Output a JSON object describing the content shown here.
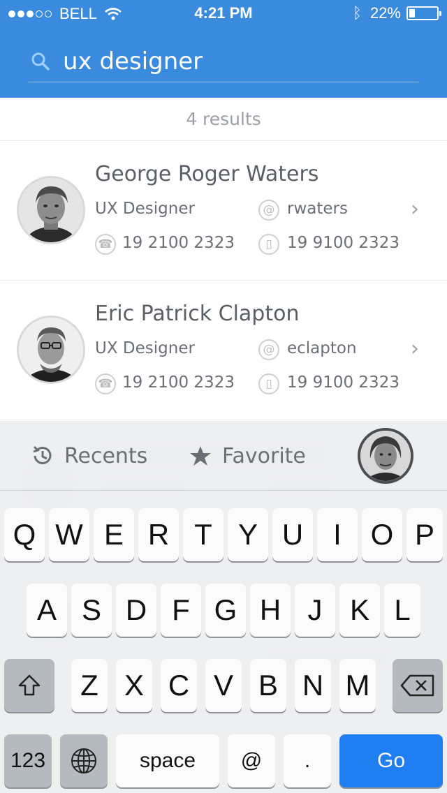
{
  "status_bar": {
    "carrier": "BELL",
    "time": "4:21 PM",
    "battery": "22%",
    "battery_level": 0.22
  },
  "search": {
    "value": "ux designer",
    "placeholder": ""
  },
  "results": {
    "count_label": "4 results",
    "items": [
      {
        "name": "George Roger Waters",
        "title": "UX Designer",
        "handle": "rwaters",
        "phone": "19 2100 2323",
        "mobile": "19 9100 2323"
      },
      {
        "name": "Eric Patrick Clapton",
        "title": "UX Designer",
        "handle": "eclapton",
        "phone": "19 2100 2323",
        "mobile": "19 9100 2323"
      }
    ]
  },
  "tabs": {
    "recents": "Recents",
    "favorite": "Favorite"
  },
  "keyboard": {
    "row1": [
      "Q",
      "W",
      "E",
      "R",
      "T",
      "Y",
      "U",
      "I",
      "O",
      "P"
    ],
    "row2": [
      "A",
      "S",
      "D",
      "F",
      "G",
      "H",
      "J",
      "K",
      "L"
    ],
    "row3": [
      "Z",
      "X",
      "C",
      "V",
      "B",
      "N",
      "M"
    ],
    "numbers": "123",
    "space": "space",
    "at": "@",
    "period": ".",
    "go": "Go"
  },
  "colors": {
    "header": "#3a8bde",
    "go_key": "#1e7ef2"
  }
}
